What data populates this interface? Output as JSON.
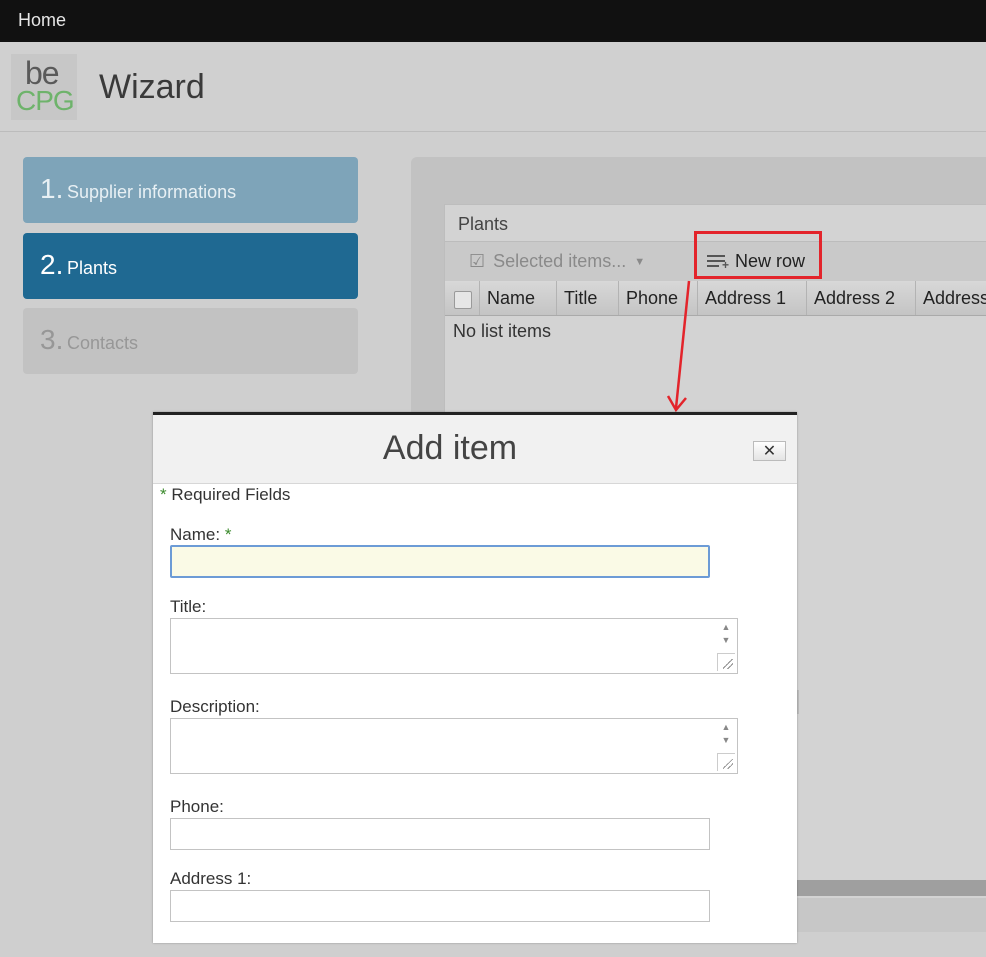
{
  "topbar": {
    "home": "Home"
  },
  "header": {
    "logo_top": "be",
    "logo_bottom": "CPG",
    "title": "Wizard"
  },
  "steps": [
    {
      "num": "1.",
      "label": "Supplier informations"
    },
    {
      "num": "2.",
      "label": "Plants"
    },
    {
      "num": "3.",
      "label": "Contacts"
    }
  ],
  "plants": {
    "title": "Plants",
    "selected_items": "Selected items...",
    "new_row": "New row",
    "columns": [
      "Name",
      "Title",
      "Phone",
      "Address 1",
      "Address 2",
      "Address"
    ],
    "empty": "No list items"
  },
  "dialog": {
    "title": "Add item",
    "close": "✕",
    "required_note": "Required Fields",
    "required_star": "*",
    "fields": {
      "name": "Name:",
      "title": "Title:",
      "description": "Description:",
      "phone": "Phone:",
      "address1": "Address 1:"
    }
  },
  "colors": {
    "accent": "#1f6992",
    "highlight": "#e3242b",
    "required": "#3b8a2c"
  }
}
